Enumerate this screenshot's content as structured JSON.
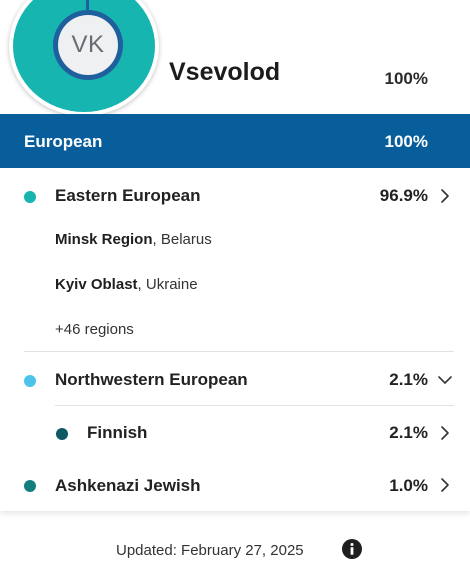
{
  "profile": {
    "initials": "VK",
    "name": "Vsevolod",
    "percent": "100%"
  },
  "region": {
    "label": "European",
    "percent": "100%"
  },
  "ancestry": [
    {
      "label": "Eastern European",
      "percent": "96.9%",
      "color": "#16b5b0",
      "chevron": "chevron-right",
      "subregions": [
        {
          "name": "Minsk Region",
          "country": ", Belarus"
        },
        {
          "name": "Kyiv Oblast",
          "country": ", Ukraine"
        }
      ],
      "more": "+46 regions"
    },
    {
      "label": "Northwestern European",
      "percent": "2.1%",
      "color": "#4cc3ea",
      "chevron": "chevron-down",
      "children": [
        {
          "label": "Finnish",
          "percent": "2.1%",
          "color": "#0e5964",
          "chevron": "chevron-right"
        }
      ]
    },
    {
      "label": "Ashkenazi Jewish",
      "percent": "1.0%",
      "color": "#137f7c",
      "chevron": "chevron-right"
    }
  ],
  "footer": {
    "updated": "Updated: February 27, 2025",
    "icon": "info-icon"
  },
  "colors": {
    "band": "#085d9b",
    "teal": "#16b5b0",
    "ring": "#1f5f9e"
  }
}
